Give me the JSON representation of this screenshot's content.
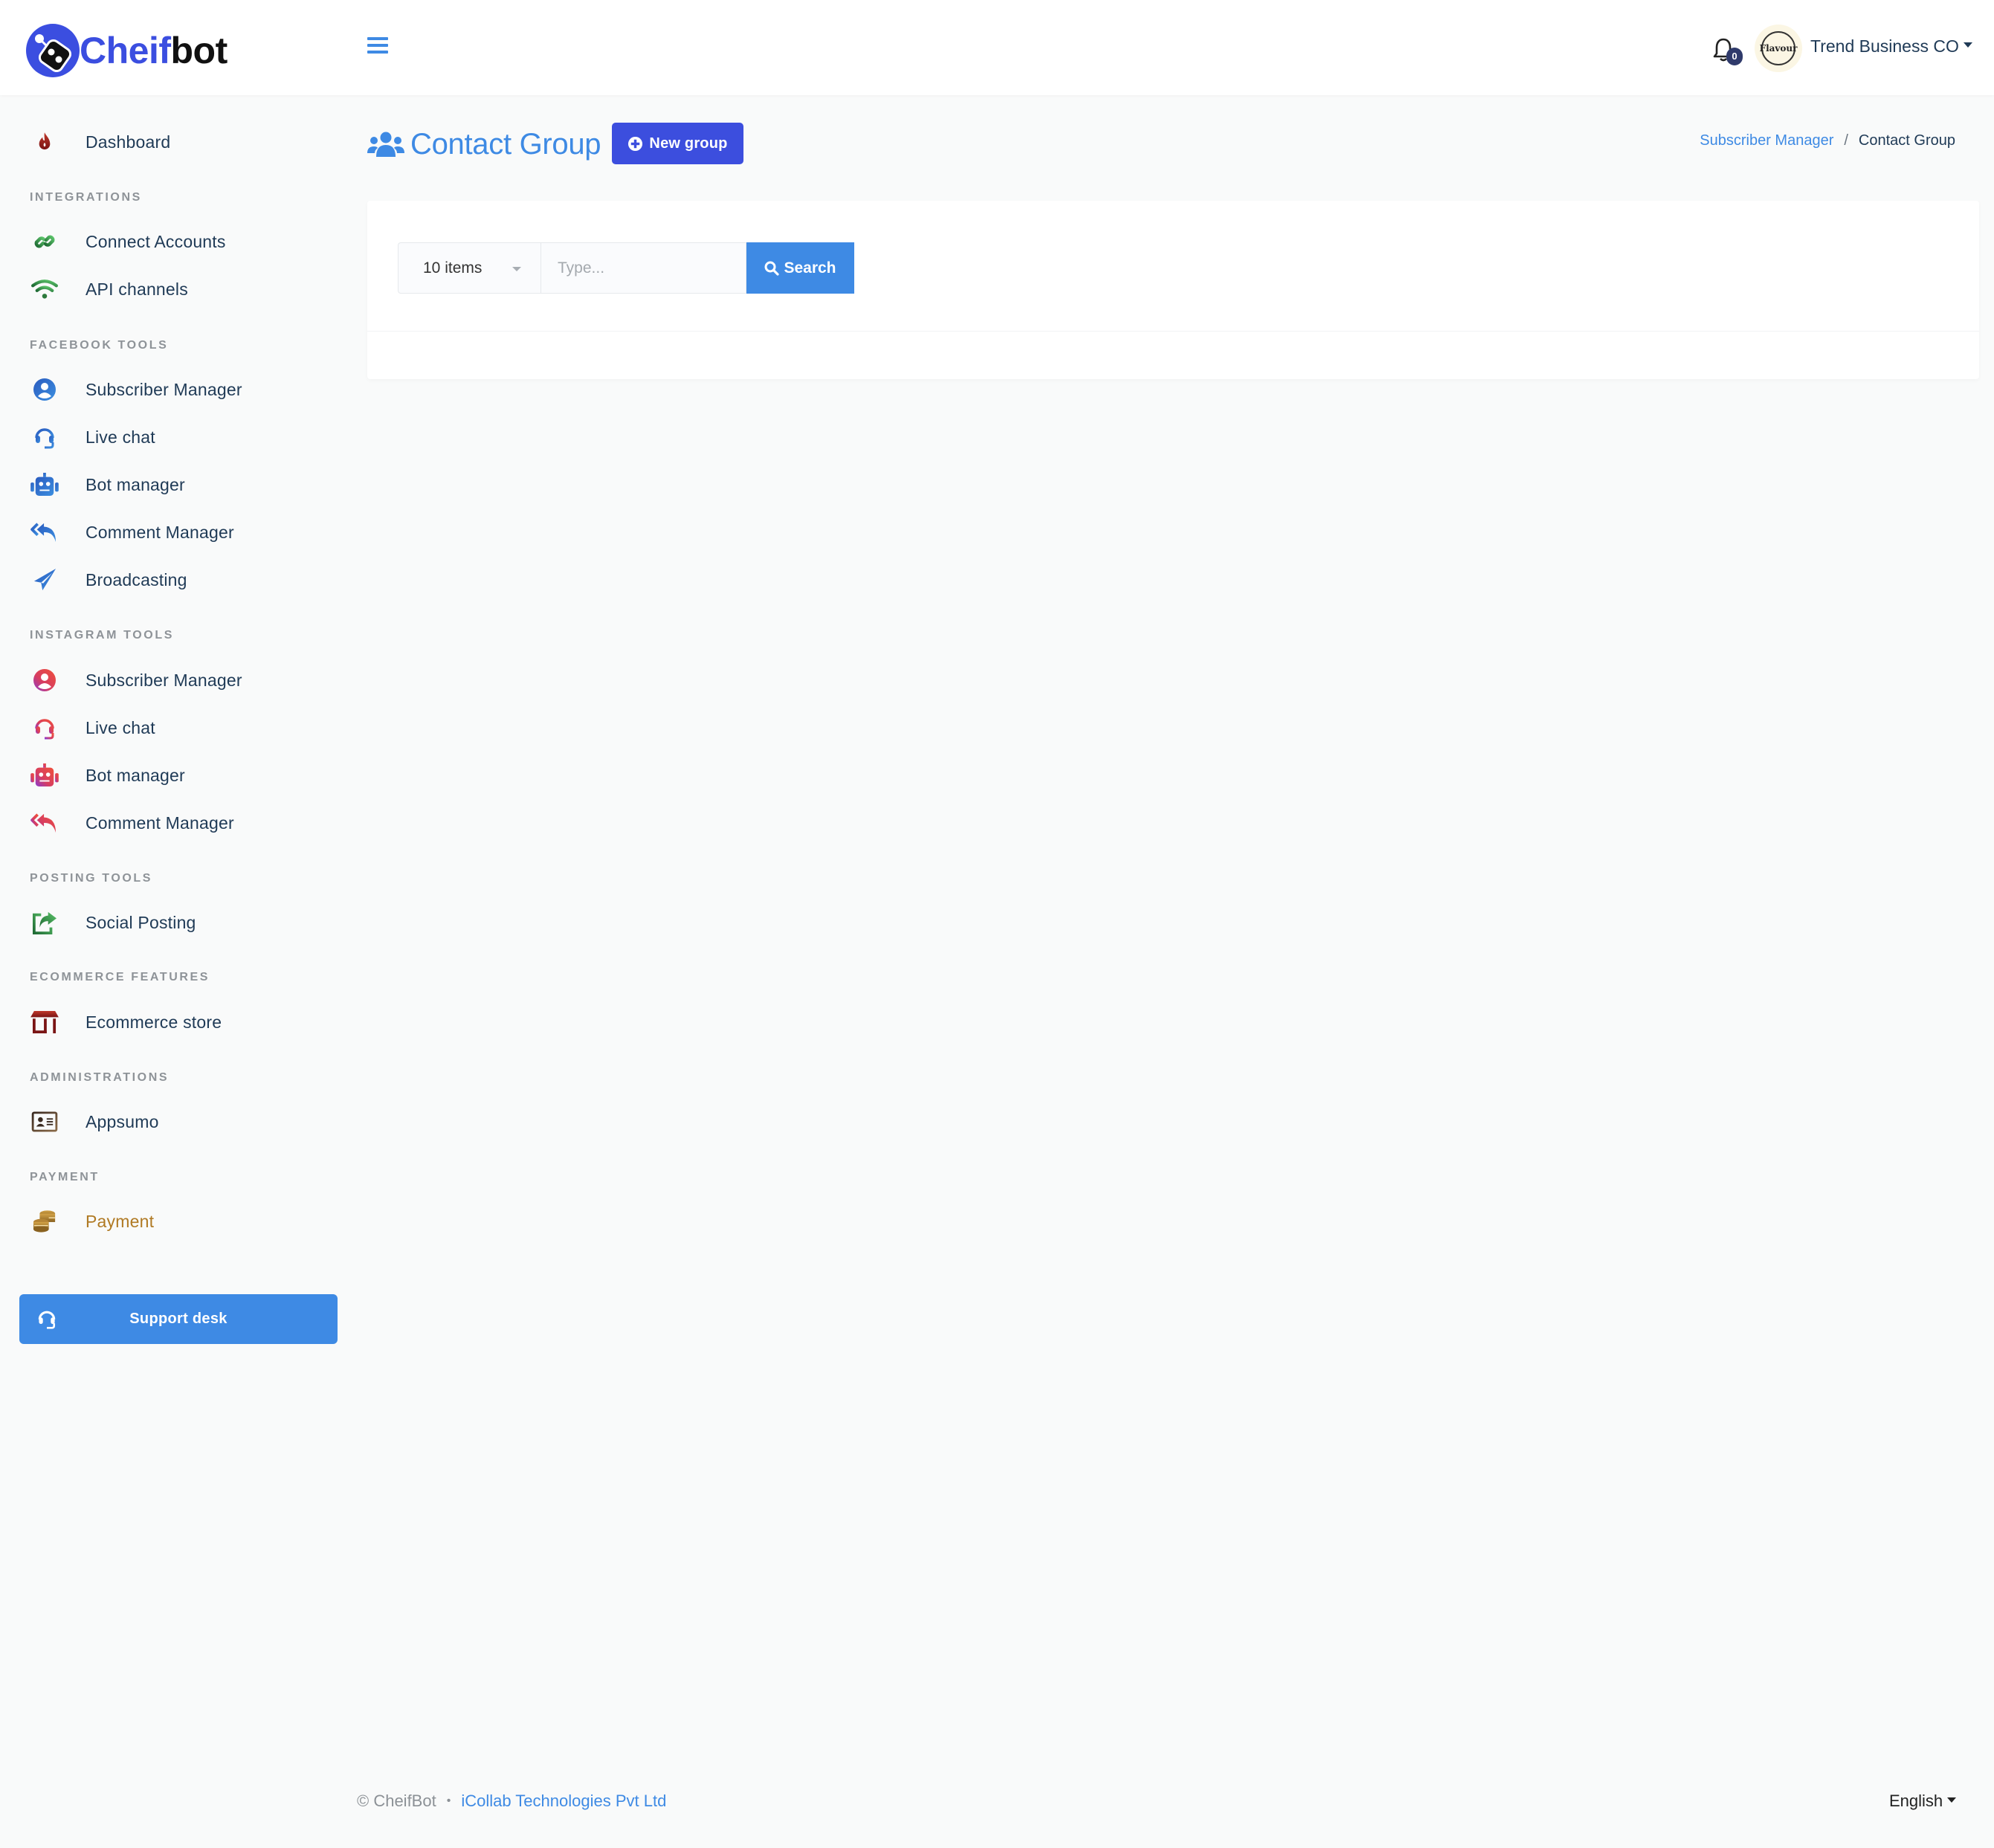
{
  "app": {
    "logo_text_primary": "Cheif",
    "logo_text_secondary": "bot",
    "brand_color": "#3c4ede",
    "accent_color": "#3e8ae4"
  },
  "header": {
    "menu_icon": "hamburger-menu-icon",
    "notifications": {
      "icon": "bell-icon",
      "count": "0"
    },
    "avatar_text": "Flavour",
    "user_name": "Trend Business CO"
  },
  "sidebar": {
    "dashboard": {
      "label": "Dashboard",
      "icon": "fire-icon"
    },
    "sections": [
      {
        "heading": "INTEGRATIONS",
        "items": [
          {
            "label": "Connect Accounts",
            "icon": "link-icon"
          },
          {
            "label": "API channels",
            "icon": "wifi-icon"
          }
        ]
      },
      {
        "heading": "FACEBOOK TOOLS",
        "items": [
          {
            "label": "Subscriber Manager",
            "icon": "user-circle-icon"
          },
          {
            "label": "Live chat",
            "icon": "headset-icon"
          },
          {
            "label": "Bot manager",
            "icon": "robot-icon"
          },
          {
            "label": "Comment Manager",
            "icon": "reply-all-icon"
          },
          {
            "label": "Broadcasting",
            "icon": "paper-plane-icon"
          }
        ]
      },
      {
        "heading": "INSTAGRAM TOOLS",
        "items": [
          {
            "label": "Subscriber Manager",
            "icon": "user-circle-icon"
          },
          {
            "label": "Live chat",
            "icon": "headset-icon"
          },
          {
            "label": "Bot manager",
            "icon": "robot-icon"
          },
          {
            "label": "Comment Manager",
            "icon": "reply-all-icon"
          }
        ]
      },
      {
        "heading": "POSTING TOOLS",
        "items": [
          {
            "label": "Social Posting",
            "icon": "share-square-icon"
          }
        ]
      },
      {
        "heading": "ECOMMERCE FEATURES",
        "items": [
          {
            "label": "Ecommerce store",
            "icon": "store-icon"
          }
        ]
      },
      {
        "heading": "ADMINISTRATIONS",
        "items": [
          {
            "label": "Appsumo",
            "icon": "id-card-icon"
          }
        ]
      },
      {
        "heading": "PAYMENT",
        "items": [
          {
            "label": "Payment",
            "icon": "coins-icon"
          }
        ]
      }
    ],
    "support_button": {
      "label": "Support desk",
      "icon": "headset-icon"
    }
  },
  "main": {
    "title": "Contact Group",
    "title_icon": "users-icon",
    "new_button_label": "New group",
    "breadcrumb": {
      "parent": "Subscriber Manager",
      "separator": "/",
      "current": "Contact Group"
    },
    "filter": {
      "page_size_selected": "10 items",
      "search_placeholder": "Type...",
      "search_value": "",
      "search_button_label": "Search"
    }
  },
  "footer": {
    "copyright": "© CheifBot",
    "separator": "•",
    "company": "iCollab Technologies Pvt Ltd",
    "language": "English"
  }
}
